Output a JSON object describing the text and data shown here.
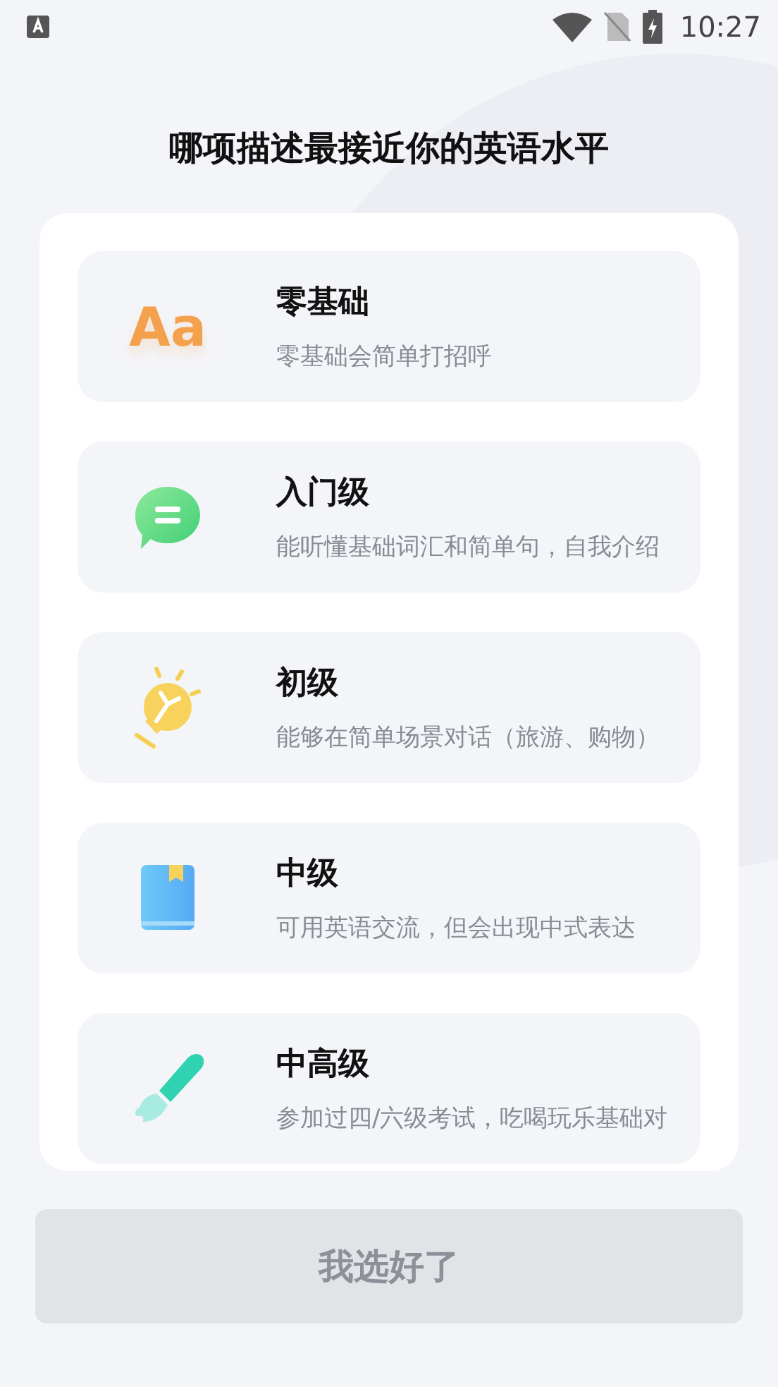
{
  "status_bar": {
    "time": "10:27"
  },
  "title": "哪项描述最接近你的英语水平",
  "levels": [
    {
      "kind": "letters",
      "icon_text": "Aa",
      "name": "零基础",
      "description": "零基础会简单打招呼",
      "selected": false
    },
    {
      "kind": "chat",
      "name": "入门级",
      "description": "能听懂基础词汇和简单句，自我介绍",
      "selected": false
    },
    {
      "kind": "bulb",
      "name": "初级",
      "description": "能够在简单场景对话（旅游、购物）",
      "selected": false
    },
    {
      "kind": "book",
      "name": "中级",
      "description": "可用英语交流，但会出现中式表达",
      "selected": false
    },
    {
      "kind": "brush",
      "name": "中高级",
      "description": "参加过四/六级考试，吃喝玩乐基础对",
      "selected": false
    }
  ],
  "confirm_button": {
    "label": "我选好了",
    "disabled": true
  }
}
